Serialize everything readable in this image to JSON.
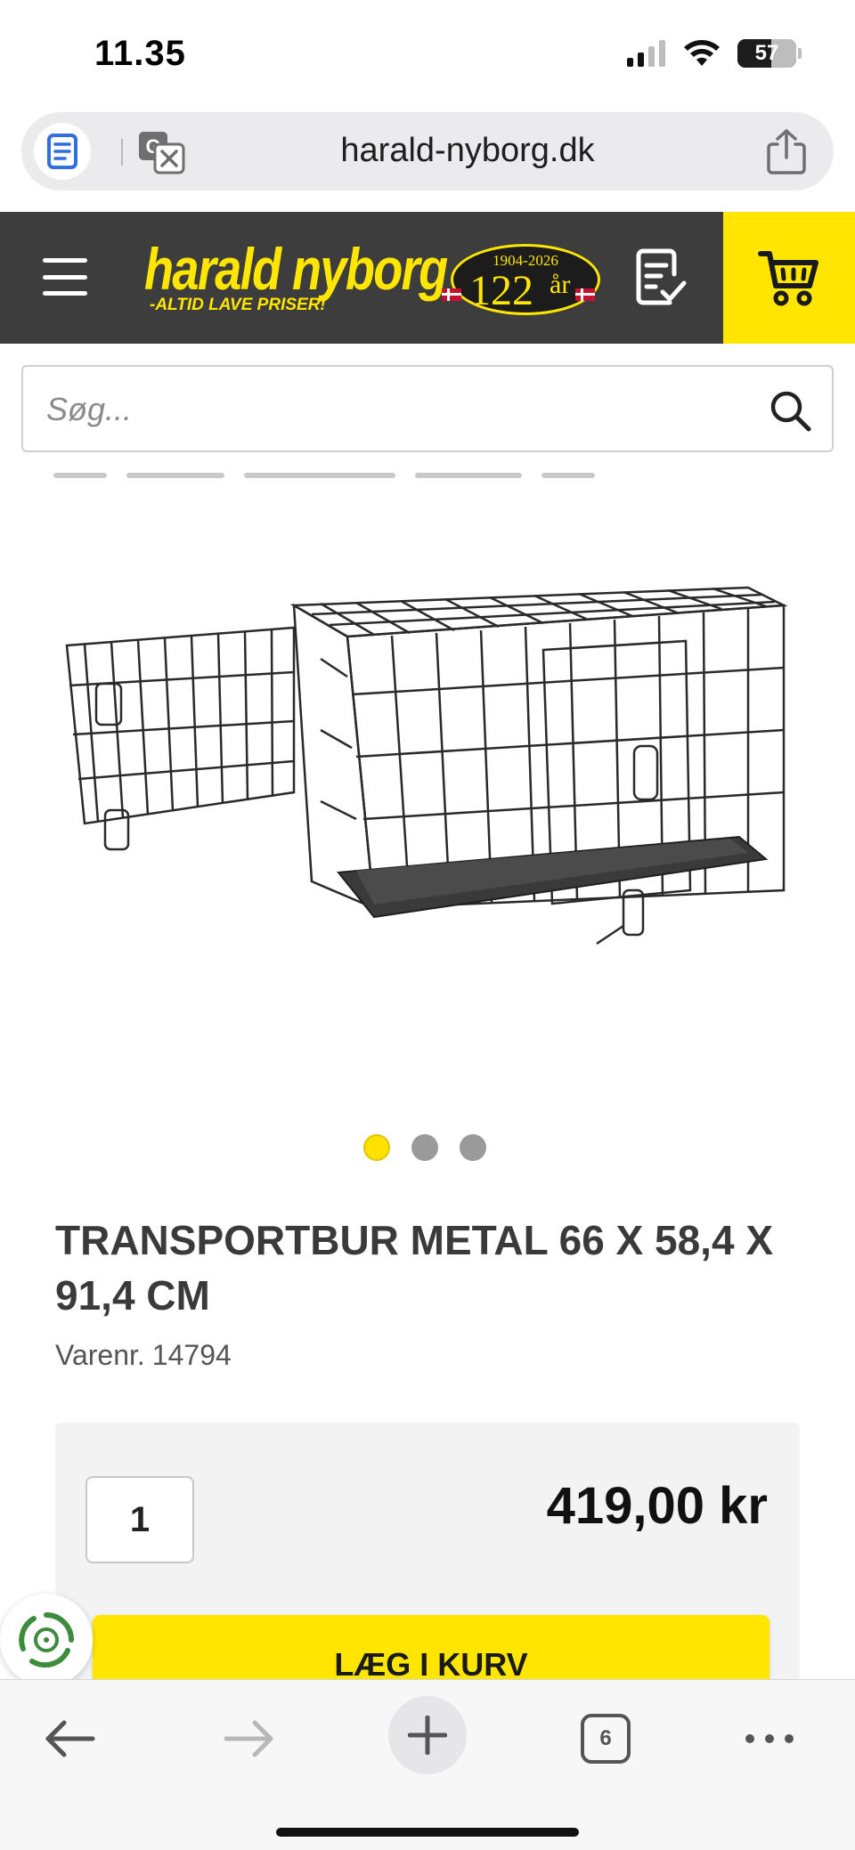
{
  "status_bar": {
    "time": "11.35",
    "battery": "57"
  },
  "browser": {
    "url": "harald-nyborg.dk",
    "icons": {
      "reader": "reader-icon",
      "translate": "translate-icon",
      "share": "share-icon"
    }
  },
  "header": {
    "brand_name": "harald nyborg",
    "tagline": "-ALTID LAVE PRISER!",
    "badge_years": "1904-2026",
    "badge_number": "122",
    "badge_unit": "år",
    "colors": {
      "header_bg": "#3d3d3d",
      "brand_yellow": "#ffe600"
    },
    "icons": {
      "menu": "hamburger-menu-icon",
      "list": "shopping-list-icon",
      "cart": "cart-icon"
    }
  },
  "search": {
    "placeholder": "Søg...",
    "icon": "search-icon"
  },
  "product": {
    "title": "TRANSPORTBUR METAL 66 X 58,4 X 91,4 CM",
    "sku_label": "Varenr.",
    "sku": "14794",
    "image_alt": "wire-dog-crate-image",
    "carousel": {
      "count": 3,
      "active_index": 0
    }
  },
  "purchase": {
    "quantity": "1",
    "price": "419,00 kr",
    "add_to_cart": "LÆG I KURV"
  },
  "toolbar": {
    "tab_count": "6",
    "icons": {
      "back": "back-arrow-icon",
      "forward": "forward-arrow-icon",
      "new_tab": "plus-icon",
      "tabs": "tabs-icon",
      "more": "more-icon"
    }
  }
}
